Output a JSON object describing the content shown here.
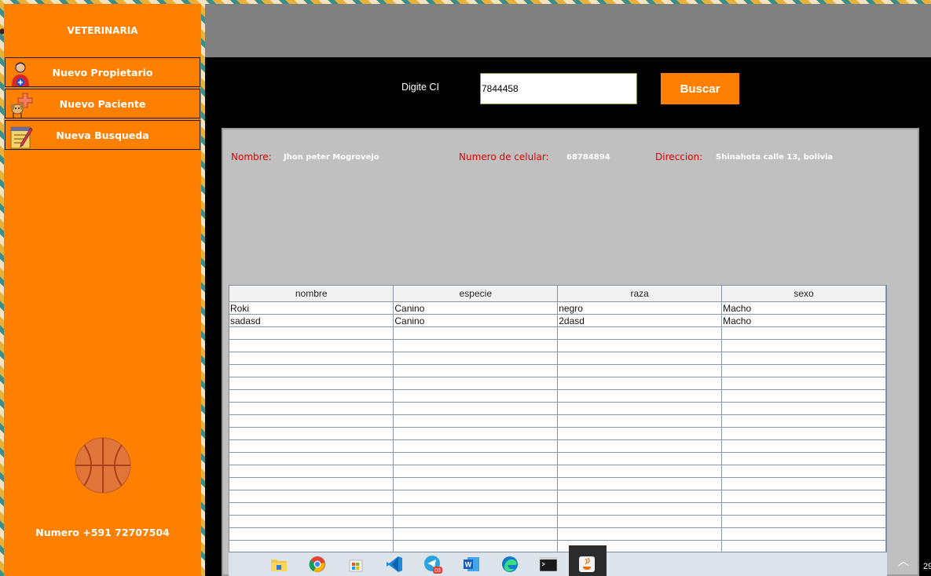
{
  "app": {
    "brand": "VETERINARIA"
  },
  "sidebar": {
    "items": [
      {
        "label": "Nuevo Propietario",
        "icon": "person-add-icon"
      },
      {
        "label": "Nuevo Paciente",
        "icon": "pet-add-icon"
      },
      {
        "label": "Nueva Busqueda",
        "icon": "notepad-search-icon"
      }
    ],
    "logo_icon": "basketball-icon",
    "phone": "Numero +591 72707504"
  },
  "search": {
    "label": "Digite CI",
    "value": "7844458",
    "button": "Buscar"
  },
  "owner": {
    "name_label": "Nombre:",
    "name_value": "Jhon peter Mogrovejo",
    "phone_label": "Numero de celular:",
    "phone_value": "68784894",
    "address_label": "Direccion:",
    "address_value": "Shinahota calle 13, bolivia"
  },
  "table": {
    "columns": [
      "nombre",
      "especie",
      "raza",
      "sexo"
    ],
    "rows": [
      [
        "Roki",
        "Canino",
        "negro",
        "Macho"
      ],
      [
        "sadasd",
        "Canino",
        "2dasd",
        "Macho"
      ]
    ],
    "empty_rows": 19
  },
  "taskbar": {
    "apps": [
      "file-explorer-icon",
      "chrome-icon",
      "store-icon",
      "vscode-icon",
      "telegram-icon",
      "word-icon",
      "edge-icon",
      "terminal-icon",
      "java-icon"
    ],
    "telegram_badge": "03",
    "tray_number": "29"
  },
  "colors": {
    "accent": "#ff8000",
    "label_red": "#e00000",
    "panel": "#c0c0c0"
  }
}
